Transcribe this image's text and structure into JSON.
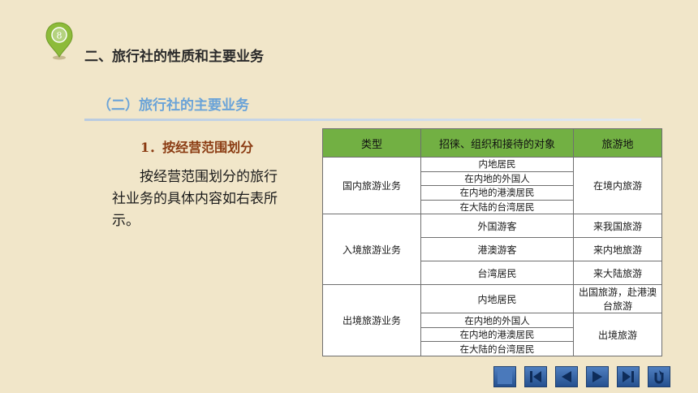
{
  "badge": {
    "number": "8"
  },
  "header": {
    "title": "二、旅行社的性质和主要业务"
  },
  "section": {
    "title": "（二）旅行社的主要业务"
  },
  "subsection": {
    "title": "1．按经营范围划分"
  },
  "paragraph": "按经营范围划分的旅行社业务的具体内容如右表所示。",
  "table": {
    "headers": [
      "类型",
      "招徕、组织和接待的对象",
      "旅游地"
    ],
    "groups": [
      {
        "type": "国内旅游业务",
        "targets": [
          "内地居民",
          "在内地的外国人",
          "在内地的港澳居民",
          "在大陆的台湾居民"
        ],
        "destination": "在境内旅游"
      },
      {
        "type": "入境旅游业务",
        "rows": [
          {
            "target": "外国游客",
            "destination": "来我国旅游"
          },
          {
            "target": "港澳游客",
            "destination": "来内地旅游"
          },
          {
            "target": "台湾居民",
            "destination": "来大陆旅游"
          }
        ]
      },
      {
        "type": "出境旅游业务",
        "first_target": "内地居民",
        "first_destination": "出国旅游，赴港澳台旅游",
        "targets": [
          "在内地的外国人",
          "在内地的港澳居民",
          "在大陆的台湾居民"
        ],
        "destination": "出境旅游"
      }
    ]
  },
  "navigation": {
    "icons": [
      "stop-square-icon",
      "first-page-icon",
      "previous-icon",
      "next-icon",
      "last-page-icon",
      "return-icon"
    ]
  },
  "colors": {
    "background": "#f1e6c9",
    "header_green": "#72b043",
    "section_blue": "#6aa3d8",
    "subtitle_brown": "#8a3b12",
    "nav_blue": "#3a67a8"
  }
}
